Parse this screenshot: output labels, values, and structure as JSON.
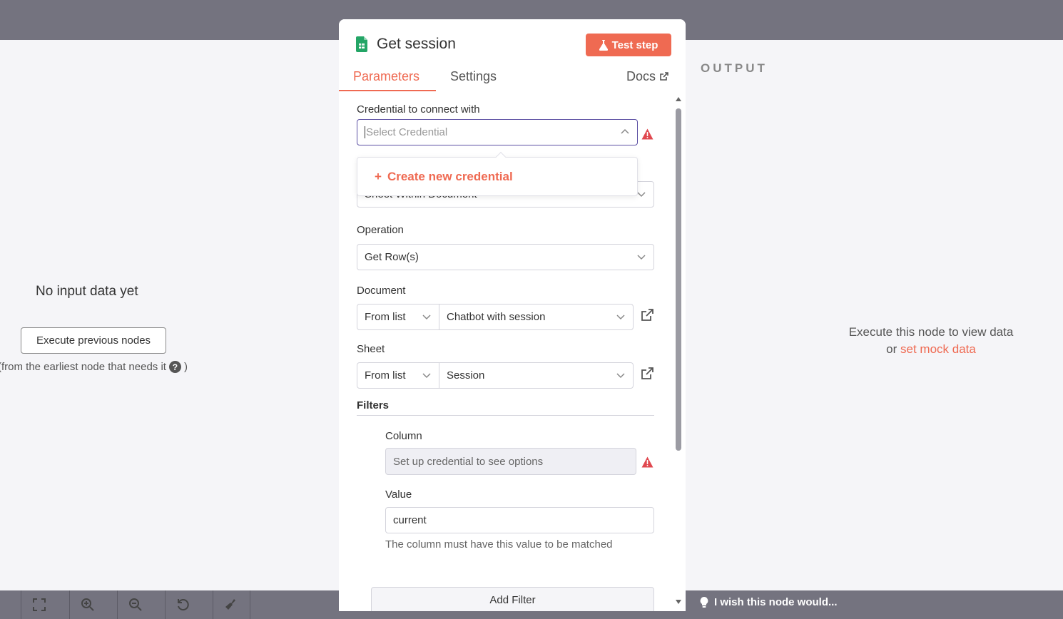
{
  "panel": {
    "title": "Get session",
    "test_step_label": "Test step",
    "tabs": [
      {
        "label": "Parameters",
        "active": true
      },
      {
        "label": "Settings",
        "active": false
      }
    ],
    "docs_label": "Docs"
  },
  "fields": {
    "credential": {
      "label": "Credential to connect with",
      "placeholder": "Select Credential",
      "dropdown_item": "Create new credential"
    },
    "resource": {
      "value": "Sheet Within Document"
    },
    "operation": {
      "label": "Operation",
      "value": "Get Row(s)"
    },
    "document": {
      "label": "Document",
      "mode": "From list",
      "value": "Chatbot with session"
    },
    "sheet": {
      "label": "Sheet",
      "mode": "From list",
      "value": "Session"
    },
    "filters": {
      "label": "Filters",
      "column_label": "Column",
      "column_placeholder": "Set up credential to see options",
      "value_label": "Value",
      "value": "current",
      "hint": "The column must have this value to be matched",
      "add_filter_label": "Add Filter"
    }
  },
  "input_pane": {
    "title": "No input data yet",
    "execute_button": "Execute previous nodes",
    "note": "(from the earliest node that needs it",
    "note_end": ")"
  },
  "output_pane": {
    "label": "OUTPUT",
    "message": "Execute this node to view data",
    "or_text": "or",
    "mock_link": "set mock data"
  },
  "footer": {
    "wish": "I wish this node would..."
  },
  "colors": {
    "accent": "#ef6a52",
    "canvas": "#74737f",
    "pane_bg": "#f5f5f8",
    "focus": "#5b4fa3",
    "warning": "#e0484f"
  }
}
